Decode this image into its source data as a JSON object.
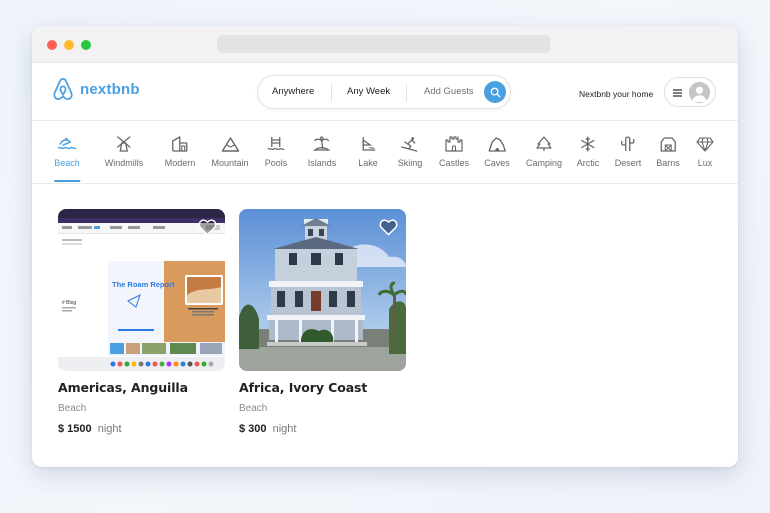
{
  "header": {
    "brand": "nextbnb",
    "search": {
      "where": "Anywhere",
      "when": "Any Week",
      "guests": "Add Guests"
    },
    "host_link": "Nextbnb your home"
  },
  "categories": [
    {
      "label": "Beach",
      "icon": "beach-icon",
      "active": true
    },
    {
      "label": "Windmills",
      "icon": "windmill-icon"
    },
    {
      "label": "Modern",
      "icon": "modern-icon"
    },
    {
      "label": "Mountain",
      "icon": "mountain-icon"
    },
    {
      "label": "Pools",
      "icon": "pool-icon"
    },
    {
      "label": "Islands",
      "icon": "island-icon"
    },
    {
      "label": "Lake",
      "icon": "lake-icon"
    },
    {
      "label": "Skiing",
      "icon": "skiing-icon"
    },
    {
      "label": "Castles",
      "icon": "castle-icon"
    },
    {
      "label": "Caves",
      "icon": "cave-icon"
    },
    {
      "label": "Camping",
      "icon": "camping-icon"
    },
    {
      "label": "Arctic",
      "icon": "snowflake-icon"
    },
    {
      "label": "Desert",
      "icon": "cactus-icon"
    },
    {
      "label": "Barns",
      "icon": "barn-icon"
    },
    {
      "label": "Lux",
      "icon": "diamond-icon"
    }
  ],
  "listings": [
    {
      "location": "Americas, Anguilla",
      "category": "Beach",
      "price": "$ 1500",
      "unit": "night",
      "thumb_text": {
        "heading": "The Roam Report",
        "blog": "# Blog"
      }
    },
    {
      "location": "Africa, Ivory Coast",
      "category": "Beach",
      "price": "$ 300",
      "unit": "night"
    }
  ],
  "colors": {
    "accent": "#4a9fe0",
    "text": "#222222",
    "muted": "#8a8a8a"
  }
}
